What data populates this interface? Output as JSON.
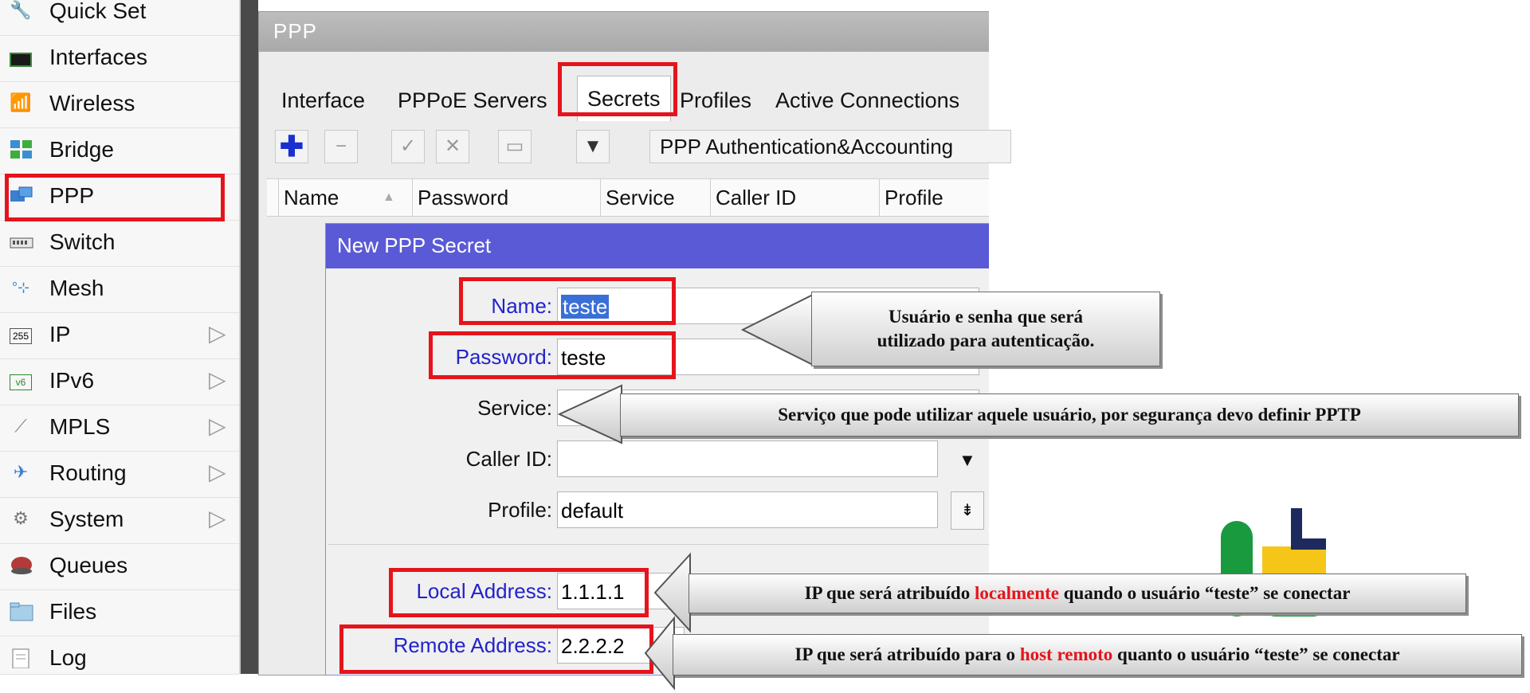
{
  "sidebar": {
    "items": [
      {
        "label": "Quick Set",
        "icon": "quick-set-icon",
        "submenu": false
      },
      {
        "label": "Interfaces",
        "icon": "interfaces-icon",
        "submenu": false
      },
      {
        "label": "Wireless",
        "icon": "wireless-icon",
        "submenu": false
      },
      {
        "label": "Bridge",
        "icon": "bridge-icon",
        "submenu": false
      },
      {
        "label": "PPP",
        "icon": "ppp-icon",
        "submenu": false
      },
      {
        "label": "Switch",
        "icon": "switch-icon",
        "submenu": false
      },
      {
        "label": "Mesh",
        "icon": "mesh-icon",
        "submenu": false
      },
      {
        "label": "IP",
        "icon": "ip-icon",
        "submenu": true
      },
      {
        "label": "IPv6",
        "icon": "ipv6-icon",
        "submenu": true
      },
      {
        "label": "MPLS",
        "icon": "mpls-icon",
        "submenu": true
      },
      {
        "label": "Routing",
        "icon": "routing-icon",
        "submenu": true
      },
      {
        "label": "System",
        "icon": "system-icon",
        "submenu": true
      },
      {
        "label": "Queues",
        "icon": "queues-icon",
        "submenu": false
      },
      {
        "label": "Files",
        "icon": "files-icon",
        "submenu": false
      },
      {
        "label": "Log",
        "icon": "log-icon",
        "submenu": false
      }
    ]
  },
  "ppp_window": {
    "title": "PPP",
    "tabs": [
      "Interface",
      "PPPoE Servers",
      "Secrets",
      "Profiles",
      "Active Connections"
    ],
    "active_tab": "Secrets",
    "toolbar": {
      "auth_button": "PPP Authentication&Accounting"
    },
    "columns": [
      "Name",
      "Password",
      "Service",
      "Caller ID",
      "Profile"
    ]
  },
  "dialog": {
    "title": "New PPP Secret",
    "fields": {
      "name": {
        "label": "Name:",
        "value": "teste"
      },
      "password": {
        "label": "Password:",
        "value": "teste"
      },
      "service": {
        "label": "Service:",
        "value": ""
      },
      "caller_id": {
        "label": "Caller ID:",
        "value": ""
      },
      "profile": {
        "label": "Profile:",
        "value": "default"
      },
      "local_address": {
        "label": "Local Address:",
        "value": "1.1.1.1"
      },
      "remote_address": {
        "label": "Remote Address:",
        "value": "2.2.2.2"
      }
    }
  },
  "callouts": {
    "c1_line1": "Usuário e senha que será",
    "c1_line2": "utilizado para autenticação.",
    "c2": "Serviço que pode utilizar aquele usuário, por segurança devo definir PPTP",
    "c3_pre": "IP que será atribuído ",
    "c3_red": "localmente",
    "c3_post": " quando o usuário “teste” se conectar",
    "c4_pre": "IP que será atribuído para o ",
    "c4_red": "host remoto",
    "c4_post": " quanto o usuário “teste” se conectar"
  },
  "colors": {
    "highlight": "#e5141c",
    "dialog_title": "#5a5ad6",
    "label_blue": "#2222cc"
  }
}
